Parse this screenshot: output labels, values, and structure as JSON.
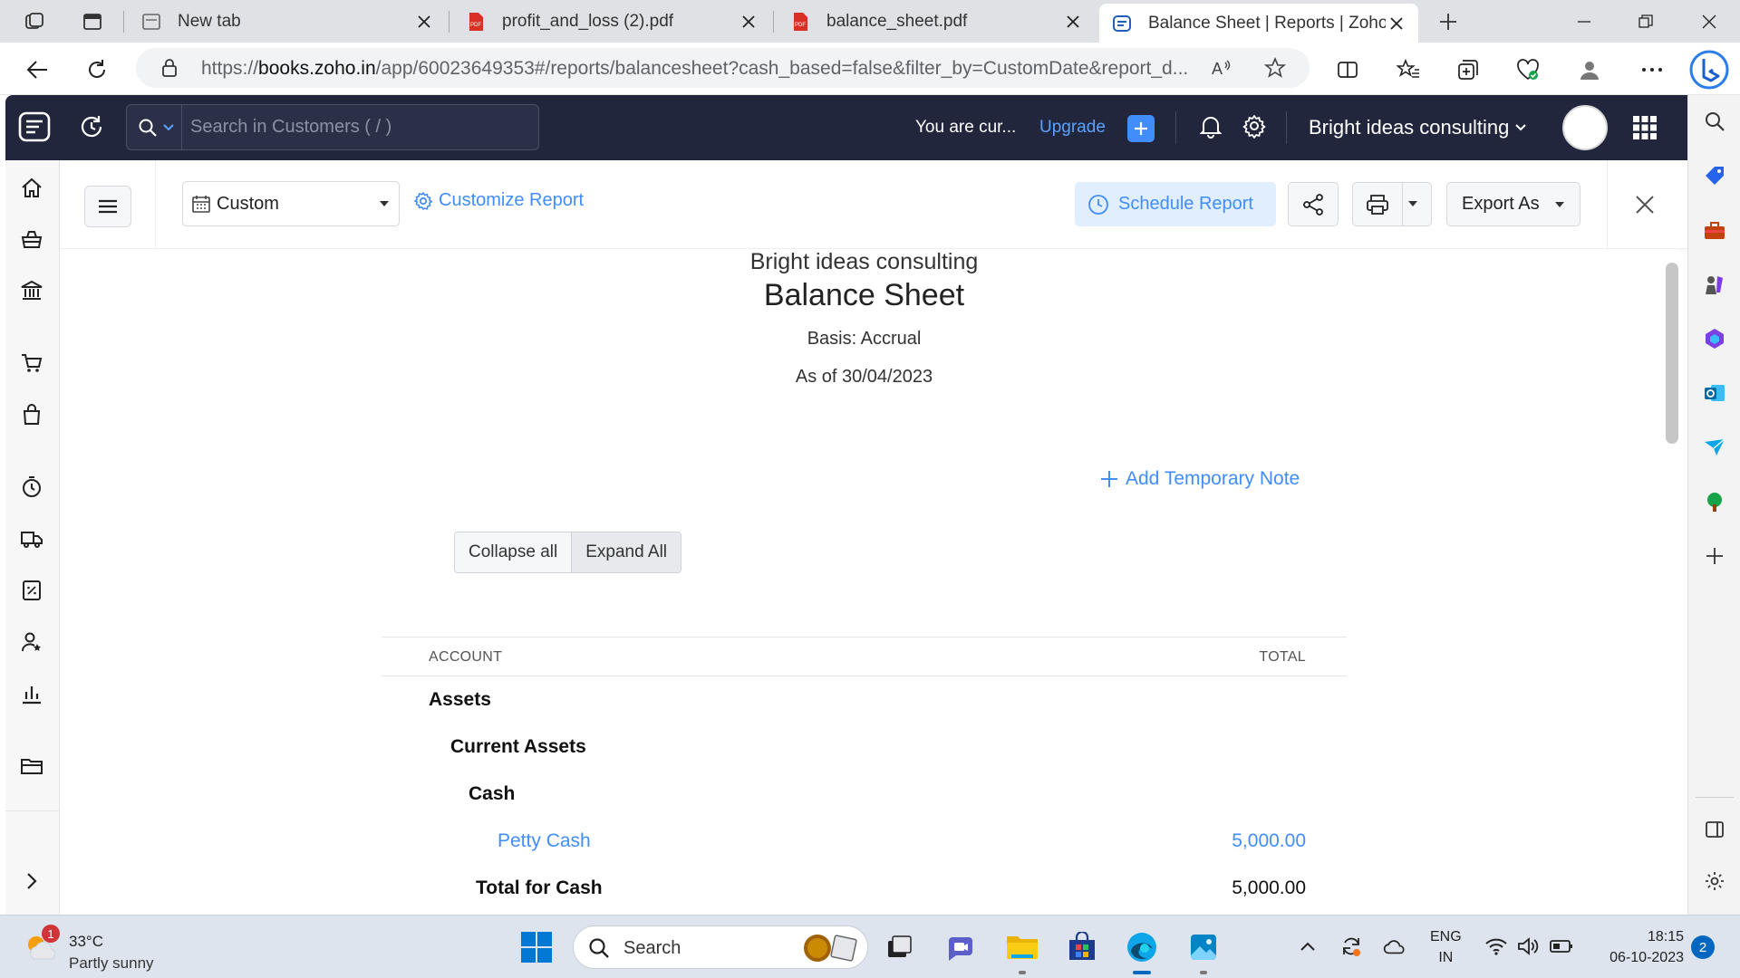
{
  "browser": {
    "tabs": [
      {
        "title": "New tab",
        "active": false
      },
      {
        "title": "profit_and_loss (2).pdf",
        "active": false
      },
      {
        "title": "balance_sheet.pdf",
        "active": false
      },
      {
        "title": "Balance Sheet | Reports | Zoho Bo",
        "active": true
      }
    ],
    "url_prefix": "https://",
    "url_host": "books.zoho.in",
    "url_path": "/app/60023649353#/reports/balancesheet?cash_based=false&filter_by=CustomDate&report_d..."
  },
  "topnav": {
    "search_placeholder": "Search in Customers ( / )",
    "trial_text": "You are cur...",
    "upgrade_label": "Upgrade",
    "org_name": "Bright ideas consulting"
  },
  "toolbar": {
    "date_range": "Custom",
    "customize_label": "Customize Report",
    "schedule_label": "Schedule Report",
    "export_label": "Export As"
  },
  "report": {
    "org": "Bright ideas consulting",
    "title": "Balance Sheet",
    "basis": "Basis: Accrual",
    "as_of": "As of 30/04/2023",
    "add_note": "Add Temporary Note",
    "collapse_label": "Collapse all",
    "expand_label": "Expand All",
    "col_account": "ACCOUNT",
    "col_total": "TOTAL",
    "rows": [
      {
        "name": "Assets",
        "amount": ""
      },
      {
        "name": "Current Assets",
        "amount": ""
      },
      {
        "name": "Cash",
        "amount": ""
      },
      {
        "name": "Petty Cash",
        "amount": "5,000.00"
      },
      {
        "name": "Total for Cash",
        "amount": "5,000.00"
      }
    ]
  },
  "taskbar": {
    "weather_badge": "1",
    "temperature": "33°C",
    "condition": "Partly sunny",
    "search_label": "Search",
    "lang_line1": "ENG",
    "lang_line2": "IN",
    "time": "18:15",
    "date": "06-10-2023",
    "notif_count": "2"
  },
  "colors": {
    "zoho_nav": "#21263c",
    "accent": "#408dfb",
    "taskbar": "#dde4ee"
  }
}
